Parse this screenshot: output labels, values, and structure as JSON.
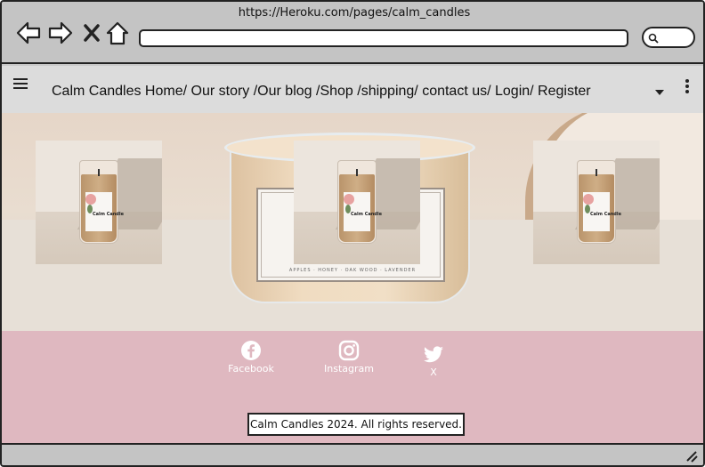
{
  "browser": {
    "url": "https://Heroku.com/pages/calm_candles",
    "back_icon": "back-arrow-icon",
    "forward_icon": "forward-arrow-icon",
    "close_icon": "close-x-icon",
    "home_icon": "home-icon",
    "search_icon": "search-icon"
  },
  "nav": {
    "menu_icon": "hamburger-menu-icon",
    "links_text": "Calm Candles Home/ Our story /Our blog /Shop /shipping/ contact us/ Login/ Register",
    "dropdown_icon": "caret-down-icon",
    "more_icon": "kebab-menu-icon"
  },
  "hero": {
    "featured_label_text": "APPLES · HONEY · OAK WOOD · LAVENDER",
    "products": [
      {
        "name": "Calm Candle"
      },
      {
        "name": "Calm Candle"
      },
      {
        "name": "Calm Candle"
      }
    ],
    "product_label_text": "Calm Candle"
  },
  "footer": {
    "social": [
      {
        "label": "Facebook",
        "icon": "facebook-icon"
      },
      {
        "label": "Instagram",
        "icon": "instagram-icon"
      },
      {
        "label": "X",
        "icon": "twitter-bird-icon"
      }
    ],
    "copyright": "Calm Candles 2024. All rights reserved."
  },
  "colors": {
    "chrome": "#c4c4c4",
    "nav_bg": "#dcdcdc",
    "footer_bg": "#dfb8c0",
    "footer_text": "#ffffff"
  }
}
